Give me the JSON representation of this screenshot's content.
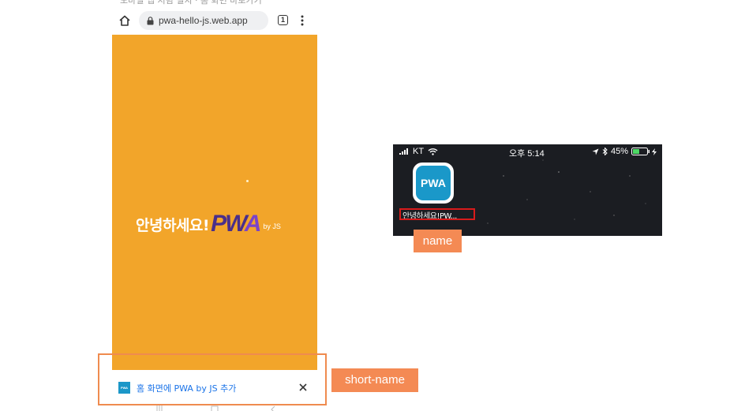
{
  "top_cut_text": "모바일 앱 처럼 설치 · 홈 화면 바로가기",
  "browser": {
    "url": "pwa-hello-js.web.app",
    "tab_count": "1"
  },
  "splash": {
    "greeting": "안녕하세요!",
    "logo_pw": "PW",
    "logo_a": "A",
    "by_js": "by JS",
    "background": "#f2a52a"
  },
  "install_banner": {
    "app_icon_text": "PWA",
    "text": "홈 화면에 PWA by JS 추가"
  },
  "annotations": {
    "short_name_tag": "short-name",
    "name_tag": "name",
    "tag_color": "#f48a54",
    "highlight_color": "#d81b1b"
  },
  "ios_homescreen": {
    "carrier": "KT",
    "time": "오후 5:14",
    "battery": "45%",
    "app_icon_text": "PWA",
    "app_label": "안녕하세요!PW..."
  },
  "icons": [
    "home-icon",
    "lock-icon",
    "menu-dots-icon",
    "close-icon",
    "signal-icon",
    "wifi-icon",
    "location-icon",
    "bluetooth-icon",
    "battery-icon",
    "charging-icon"
  ]
}
